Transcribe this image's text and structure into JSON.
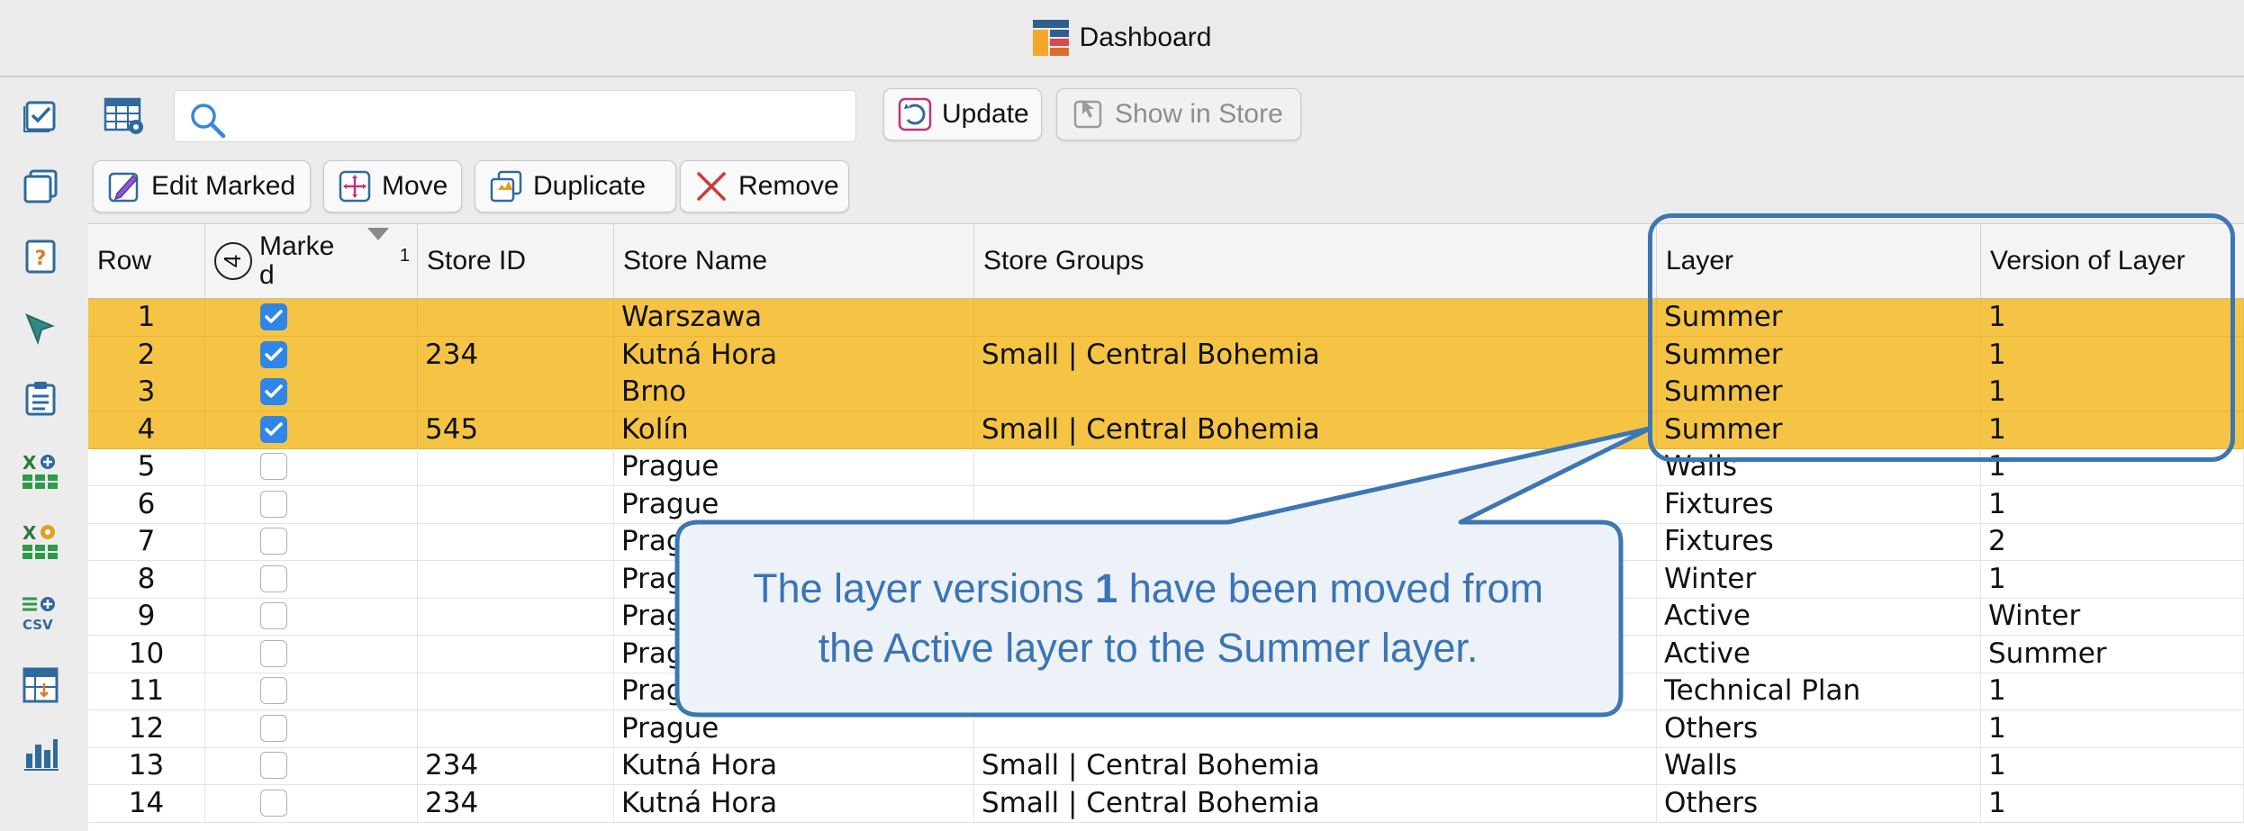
{
  "window": {
    "title": "Dashboard"
  },
  "toolbar": {
    "search_placeholder": "",
    "update_label": "Update",
    "show_in_store_label": "Show in Store",
    "edit_marked_label": "Edit Marked",
    "move_label": "Move",
    "duplicate_label": "Duplicate",
    "remove_label": "Remove"
  },
  "sidebar": {
    "icons": [
      "check-list-icon",
      "copy-window-icon",
      "help-clipboard-icon",
      "select-pointer-icon",
      "clipboard-list-icon",
      "export-grid-icon",
      "settings-grid-icon",
      "csv-export-icon",
      "table-transfer-icon",
      "bar-chart-icon"
    ],
    "csv_label": "CSV",
    "x_label": "X"
  },
  "table": {
    "headers": {
      "row": "Row",
      "marked_count": "4",
      "marked_line1": "Marke",
      "marked_line2": "d",
      "marked_sort": "1",
      "store_id": "Store ID",
      "store_name": "Store Name",
      "store_groups": "Store Groups",
      "layer": "Layer",
      "version": "Version of Layer"
    },
    "rows": [
      {
        "row": "1",
        "marked": true,
        "store_id": "",
        "store_name": "Warszawa",
        "store_groups": "",
        "layer": "Summer",
        "version": "1"
      },
      {
        "row": "2",
        "marked": true,
        "store_id": "234",
        "store_name": "Kutná Hora",
        "store_groups": "Small | Central Bohemia",
        "layer": "Summer",
        "version": "1"
      },
      {
        "row": "3",
        "marked": true,
        "store_id": "",
        "store_name": "Brno",
        "store_groups": "",
        "layer": "Summer",
        "version": "1"
      },
      {
        "row": "4",
        "marked": true,
        "store_id": "545",
        "store_name": "Kolín",
        "store_groups": "Small | Central Bohemia",
        "layer": "Summer",
        "version": "1"
      },
      {
        "row": "5",
        "marked": false,
        "store_id": "",
        "store_name": "Prague",
        "store_groups": "",
        "layer": "Walls",
        "version": "1"
      },
      {
        "row": "6",
        "marked": false,
        "store_id": "",
        "store_name": "Prague",
        "store_groups": "",
        "layer": "Fixtures",
        "version": "1"
      },
      {
        "row": "7",
        "marked": false,
        "store_id": "",
        "store_name": "Prag",
        "store_groups": "",
        "layer": "Fixtures",
        "version": "2"
      },
      {
        "row": "8",
        "marked": false,
        "store_id": "",
        "store_name": "Prag",
        "store_groups": "",
        "layer": "Winter",
        "version": "1"
      },
      {
        "row": "9",
        "marked": false,
        "store_id": "",
        "store_name": "Prag",
        "store_groups": "",
        "layer": "Active",
        "version": "Winter"
      },
      {
        "row": "10",
        "marked": false,
        "store_id": "",
        "store_name": "Prag",
        "store_groups": "",
        "layer": "Active",
        "version": "Summer"
      },
      {
        "row": "11",
        "marked": false,
        "store_id": "",
        "store_name": "Prag",
        "store_groups": "",
        "layer": "Technical Plan",
        "version": "1"
      },
      {
        "row": "12",
        "marked": false,
        "store_id": "",
        "store_name": "Prague",
        "store_groups": "",
        "layer": "Others",
        "version": "1"
      },
      {
        "row": "13",
        "marked": false,
        "store_id": "234",
        "store_name": "Kutná Hora",
        "store_groups": "Small | Central Bohemia",
        "layer": "Walls",
        "version": "1"
      },
      {
        "row": "14",
        "marked": false,
        "store_id": "234",
        "store_name": "Kutná Hora",
        "store_groups": "Small | Central Bohemia",
        "layer": "Others",
        "version": "1"
      }
    ]
  },
  "callout": {
    "text_part1": "The layer versions ",
    "text_bold": "1",
    "text_part2": " have been moved from",
    "text_line2": "the Active layer to the Summer layer."
  },
  "colors": {
    "marked_row": "#f5c445",
    "checkbox": "#2f86e8",
    "callout_border": "#3c76b3",
    "callout_text": "#3a74b6"
  }
}
